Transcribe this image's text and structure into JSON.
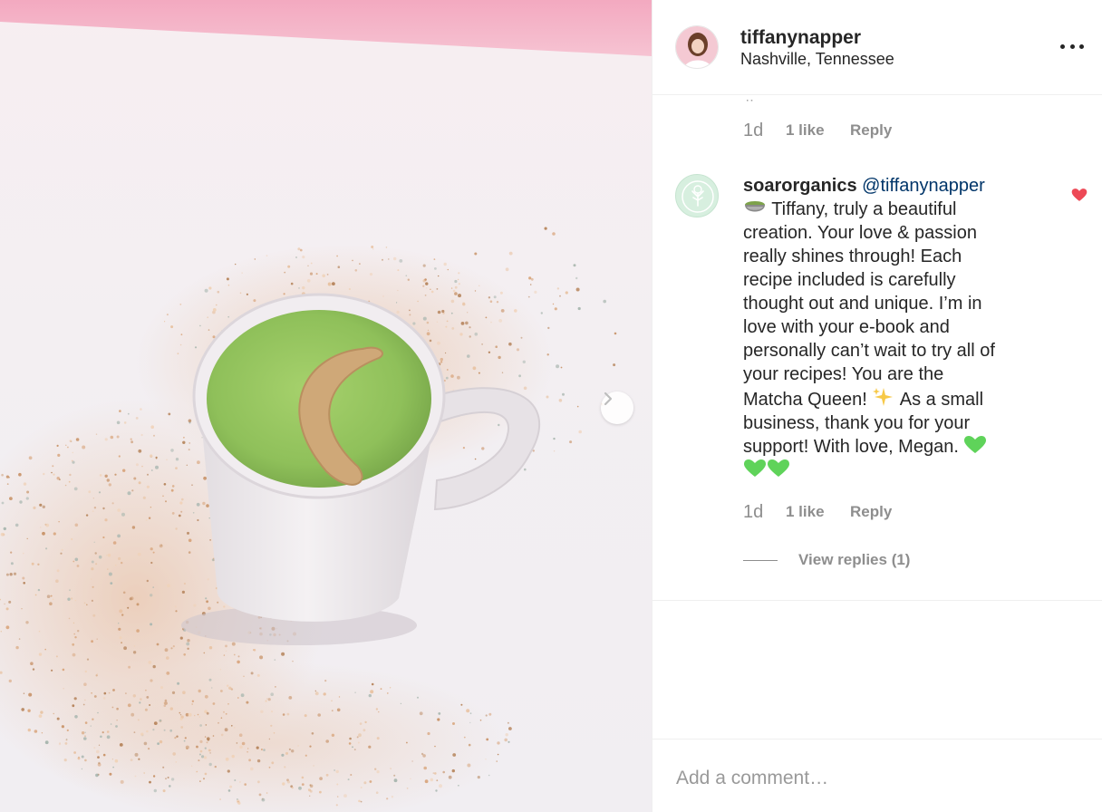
{
  "post": {
    "photo_icon": "matcha-latte-photo",
    "next_icon": "chevron-right-icon"
  },
  "header": {
    "username": "tiffanynapper",
    "location": "Nashville, Tennessee",
    "avatar_icon": "profile-avatar",
    "more_icon": "more-options-icon"
  },
  "comments": [
    {
      "time": "1d",
      "likes": "1 like",
      "reply": "Reply"
    },
    {
      "username": "soarorganics",
      "mention": "@tiffanynapper",
      "lines": [
        "Tiffany, truly a beautiful",
        "creation. Your love & passion",
        "really shines through! Each",
        "recipe included is carefully",
        "thought out and unique. I’m in",
        "love with your e-book and",
        "personally can’t wait to try all of",
        "your recipes! You are the",
        "Matcha Queen!",
        "As a small",
        "business, thank you for your",
        "support! With love, Megan."
      ],
      "time": "1d",
      "likes": "1 like",
      "reply": "Reply",
      "liked": true,
      "heart_color": "#ed4956",
      "view_replies": "View replies (1)"
    }
  ],
  "add_comment": {
    "placeholder": "Add a comment…"
  }
}
